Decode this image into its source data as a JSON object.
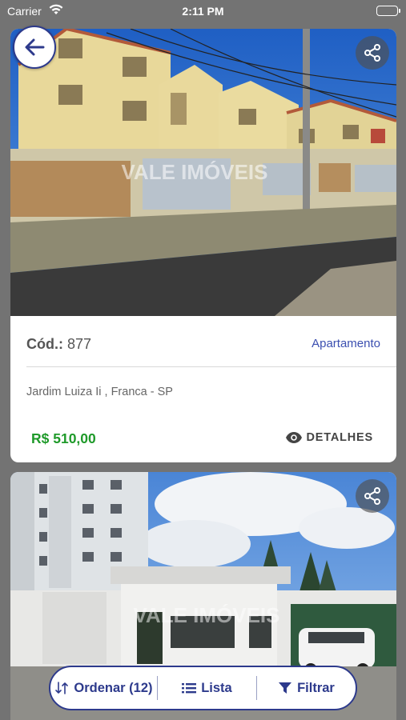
{
  "status_bar": {
    "carrier": "Carrier",
    "time": "2:11 PM"
  },
  "listings": [
    {
      "code_label": "Cód.:",
      "code_value": "877",
      "type": "Apartamento",
      "address": "Jardim Luiza Ii , Franca - SP",
      "price": "R$  510,00",
      "details_label": "DETALHES",
      "watermark": "VALE IMÓVEIS"
    },
    {
      "watermark": "VALE IMÓVEIS"
    }
  ],
  "bottom_bar": {
    "order_label": "Ordenar (12)",
    "list_label": "Lista",
    "filter_label": "Filtrar"
  },
  "colors": {
    "accent": "#2d3a8c",
    "link": "#3b4fb0",
    "price": "#1f9a2a",
    "background": "#737373"
  },
  "icons": [
    "back-arrow-icon",
    "share-icon",
    "eye-icon",
    "sort-icon",
    "list-icon",
    "filter-icon",
    "wifi-icon",
    "battery-icon"
  ]
}
